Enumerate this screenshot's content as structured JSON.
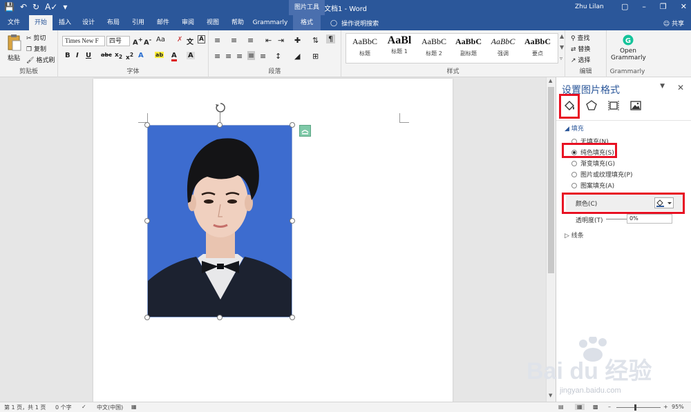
{
  "window": {
    "doc_title": "文档1 - Word",
    "tools_label": "图片工具",
    "user": "Zhu Lilan",
    "accent": "#2b579a"
  },
  "tabs": [
    {
      "label": "文件"
    },
    {
      "label": "开始"
    },
    {
      "label": "插入"
    },
    {
      "label": "设计"
    },
    {
      "label": "布局"
    },
    {
      "label": "引用"
    },
    {
      "label": "邮件"
    },
    {
      "label": "审阅"
    },
    {
      "label": "视图"
    },
    {
      "label": "帮助"
    },
    {
      "label": "Grammarly"
    },
    {
      "label": "格式"
    }
  ],
  "tellme": "操作说明搜索",
  "share": "共享",
  "ribbon": {
    "clipboard": {
      "paste": "粘贴",
      "cut": "剪切",
      "copy": "复制",
      "painter": "格式刷",
      "label": "剪贴板"
    },
    "font": {
      "name": "Times New F",
      "size": "四号",
      "label": "字体",
      "aa": "Aa"
    },
    "paragraph": {
      "label": "段落"
    },
    "styles": {
      "label": "样式",
      "items": [
        {
          "sample": "AaBbC",
          "name": "标题"
        },
        {
          "sample": "AaBl",
          "name": "标题 1"
        },
        {
          "sample": "AaBbC",
          "name": "标题 2"
        },
        {
          "sample": "AaBbC",
          "name": "副标题"
        },
        {
          "sample": "AaBbC",
          "name": "强调"
        },
        {
          "sample": "AaBbC",
          "name": "要点"
        }
      ]
    },
    "editing": {
      "find": "查找",
      "replace": "替换",
      "select": "选择",
      "label": "编辑"
    },
    "grammarly": {
      "open": "Open",
      "name": "Grammarly",
      "label": "Grammarly"
    }
  },
  "pane": {
    "title": "设置图片格式",
    "fill_section": "填充",
    "options": [
      {
        "label": "无填充(N)",
        "checked": false
      },
      {
        "label": "纯色填充(S)",
        "checked": true
      },
      {
        "label": "渐变填充(G)",
        "checked": false
      },
      {
        "label": "图片或纹理填充(P)",
        "checked": false
      },
      {
        "label": "图案填充(A)",
        "checked": false
      }
    ],
    "color_label": "颜色(C)",
    "transparency_label": "透明度(T)",
    "transparency_value": "0%",
    "line_section": "线条"
  },
  "status": {
    "page": "第 1 页，共 1 页",
    "words": "0 个字",
    "lang": "中文(中国)",
    "zoom": "95%"
  },
  "watermark": {
    "brand": "Bai du 经验",
    "url": "jingyan.baidu.com"
  },
  "colors": {
    "photo_bg": "#3d6ccf",
    "highlight": "#e81123"
  }
}
